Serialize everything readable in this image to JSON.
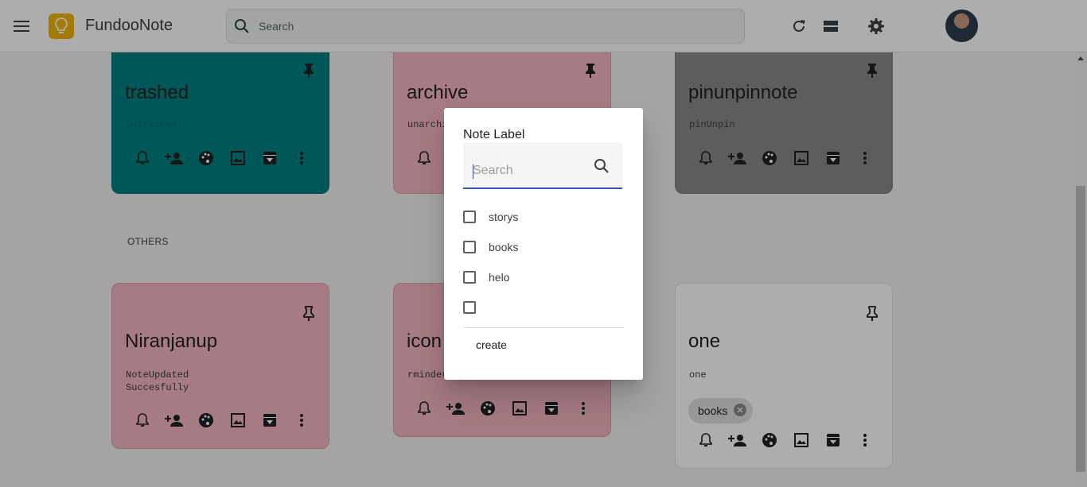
{
  "header": {
    "app_title": "FundooNote",
    "search_placeholder": "Search"
  },
  "pinned_notes": [
    {
      "title": "trashed",
      "body": "untrashed",
      "color": "#008080"
    },
    {
      "title": "archive",
      "body": "unarchived",
      "color": "#f5b6c2"
    },
    {
      "title": "pinunpinnote",
      "body": "pinUnpin",
      "color": "#8a8a8a"
    }
  ],
  "others_label": "OTHERS",
  "other_notes": [
    {
      "title": "Niranjanup",
      "body": "NoteUpdated\nSuccesfully",
      "color": "#f5b6c2"
    },
    {
      "title": "icon",
      "body": "rminder",
      "color": "#f5b6c2"
    },
    {
      "title": "one",
      "body": "one",
      "color": "#ffffff",
      "label_chip": "books"
    }
  ],
  "dialog": {
    "title": "Note Label",
    "search_placeholder": "Search",
    "labels": [
      "storys",
      "books",
      "helo",
      ""
    ],
    "create_label": "create"
  },
  "colors": {
    "accent": "#3f51b5",
    "logo": "#f4b400"
  }
}
